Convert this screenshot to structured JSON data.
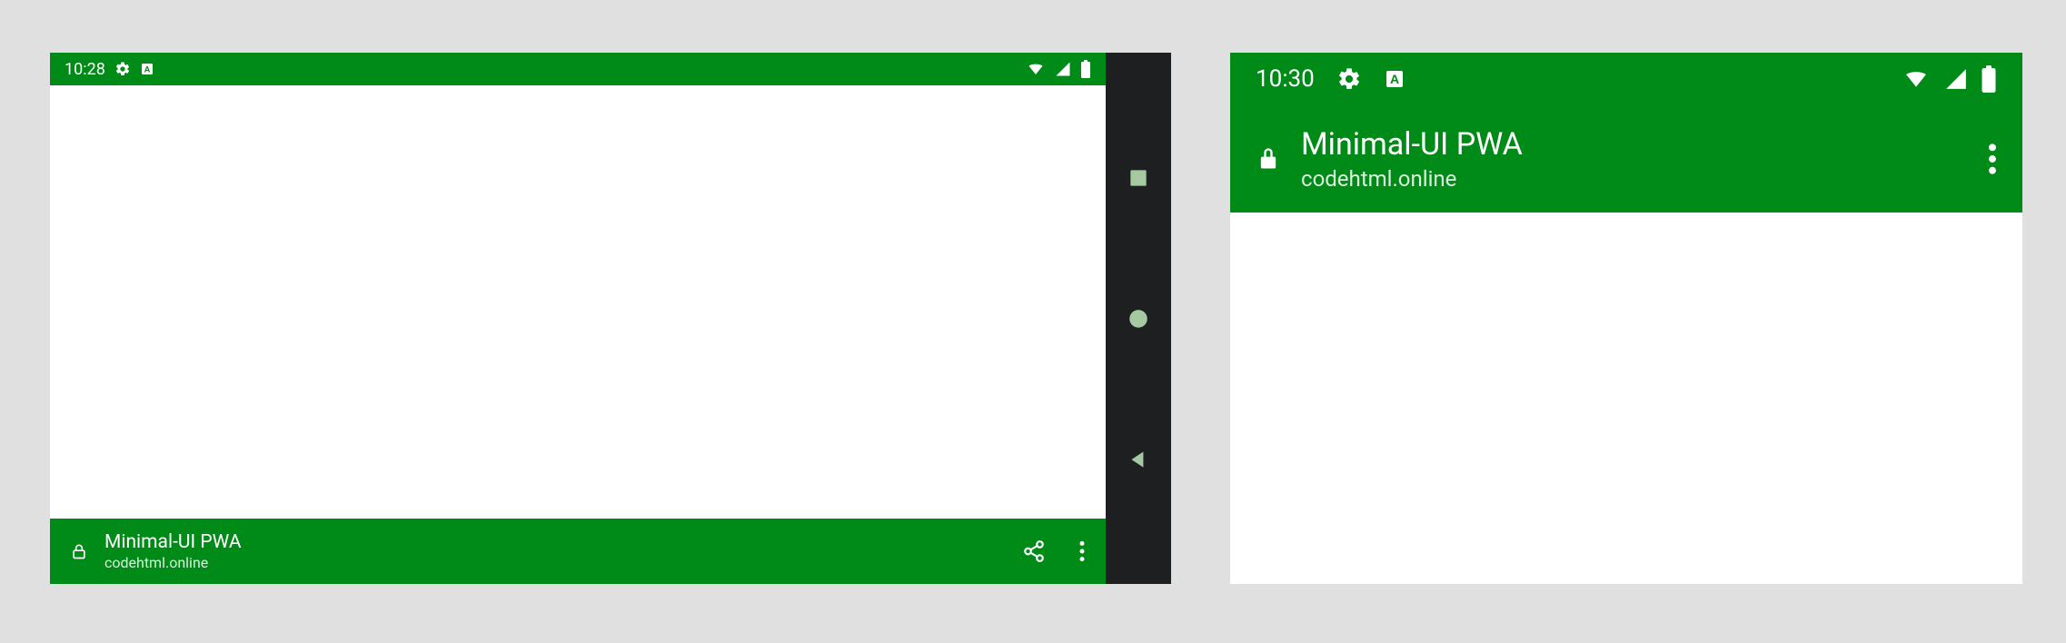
{
  "left": {
    "status": {
      "time": "10:28"
    },
    "app": {
      "title": "Minimal-UI PWA",
      "domain": "codehtml.online"
    }
  },
  "right": {
    "status": {
      "time": "10:30"
    },
    "app": {
      "title": "Minimal-UI PWA",
      "domain": "codehtml.online"
    }
  },
  "colors": {
    "theme": "#008A17",
    "navbar": "#1d1f21"
  }
}
